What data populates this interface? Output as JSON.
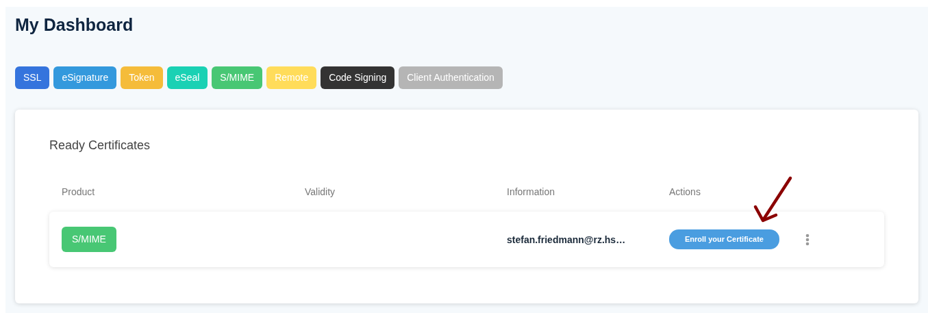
{
  "title": "My Dashboard",
  "filters": [
    {
      "label": "SSL",
      "color": "#3574dd"
    },
    {
      "label": "eSignature",
      "color": "#3399dd"
    },
    {
      "label": "Token",
      "color": "#f5bc3a"
    },
    {
      "label": "eSeal",
      "color": "#1ad1b4"
    },
    {
      "label": "S/MIME",
      "color": "#48c774"
    },
    {
      "label": "Remote",
      "color": "#ffdc5a"
    },
    {
      "label": "Code Signing",
      "color": "#333333"
    },
    {
      "label": "Client Authentication",
      "color": "#b5b5b5"
    }
  ],
  "section_title": "Ready Certificates",
  "table": {
    "columns": [
      "Product",
      "Validity",
      "Information",
      "Actions"
    ],
    "rows": [
      {
        "product": {
          "label": "S/MIME",
          "color": "#48c774"
        },
        "information": "stefan.friedmann@rz.hs…",
        "action": "Enroll your Certificate"
      }
    ]
  }
}
